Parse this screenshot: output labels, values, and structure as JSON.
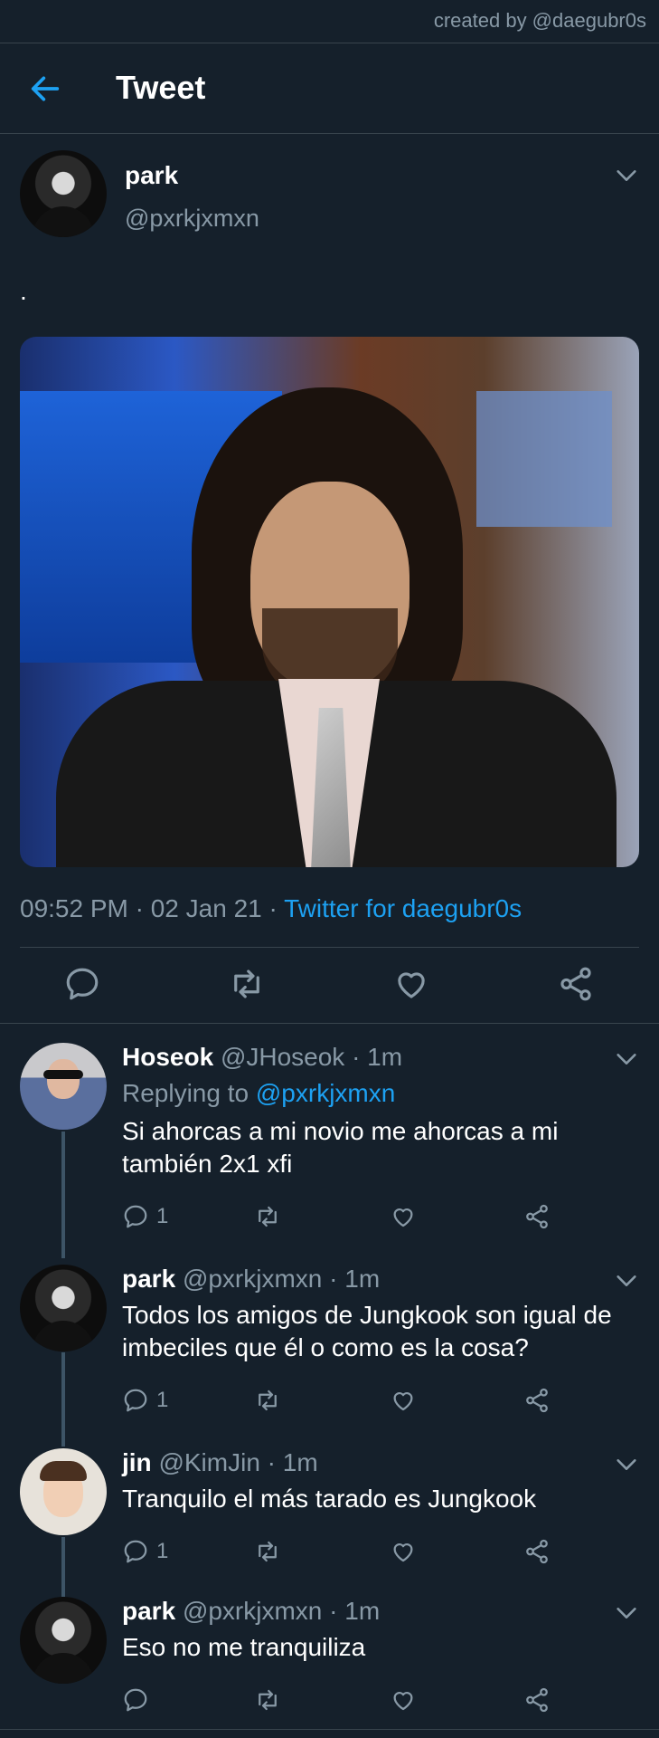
{
  "watermark": "created by @daegubr0s",
  "header": {
    "title": "Tweet"
  },
  "tweet": {
    "name": "park",
    "handle": "@pxrkjxmxn",
    "text": ".",
    "time": "09:52 PM · 02 Jan 21 · ",
    "source": "Twitter for daegubr0s"
  },
  "replies": [
    {
      "name": "Hoseok",
      "handle": "@JHoseok · 1m",
      "replying_prefix": "Replying to ",
      "replying_to": "@pxrkjxmxn",
      "text": "Si ahorcas a mi novio me ahorcas a mi también 2x1 xfi",
      "reply_count": "1"
    },
    {
      "name": "park",
      "handle": "@pxrkjxmxn · 1m",
      "text": "Todos los amigos de Jungkook son igual de imbeciles que él o como es la cosa?",
      "reply_count": "1"
    },
    {
      "name": "jin",
      "handle": "@KimJin · 1m",
      "text": "Tranquilo el más tarado es Jungkook",
      "reply_count": "1"
    },
    {
      "name": "park",
      "handle": "@pxrkjxmxn · 1m",
      "text": "Eso no me tranquiliza",
      "reply_count": ""
    }
  ],
  "colors": {
    "background": "#15202b",
    "accent": "#1da1f2",
    "muted": "#8899a6",
    "divider": "#38444d"
  }
}
